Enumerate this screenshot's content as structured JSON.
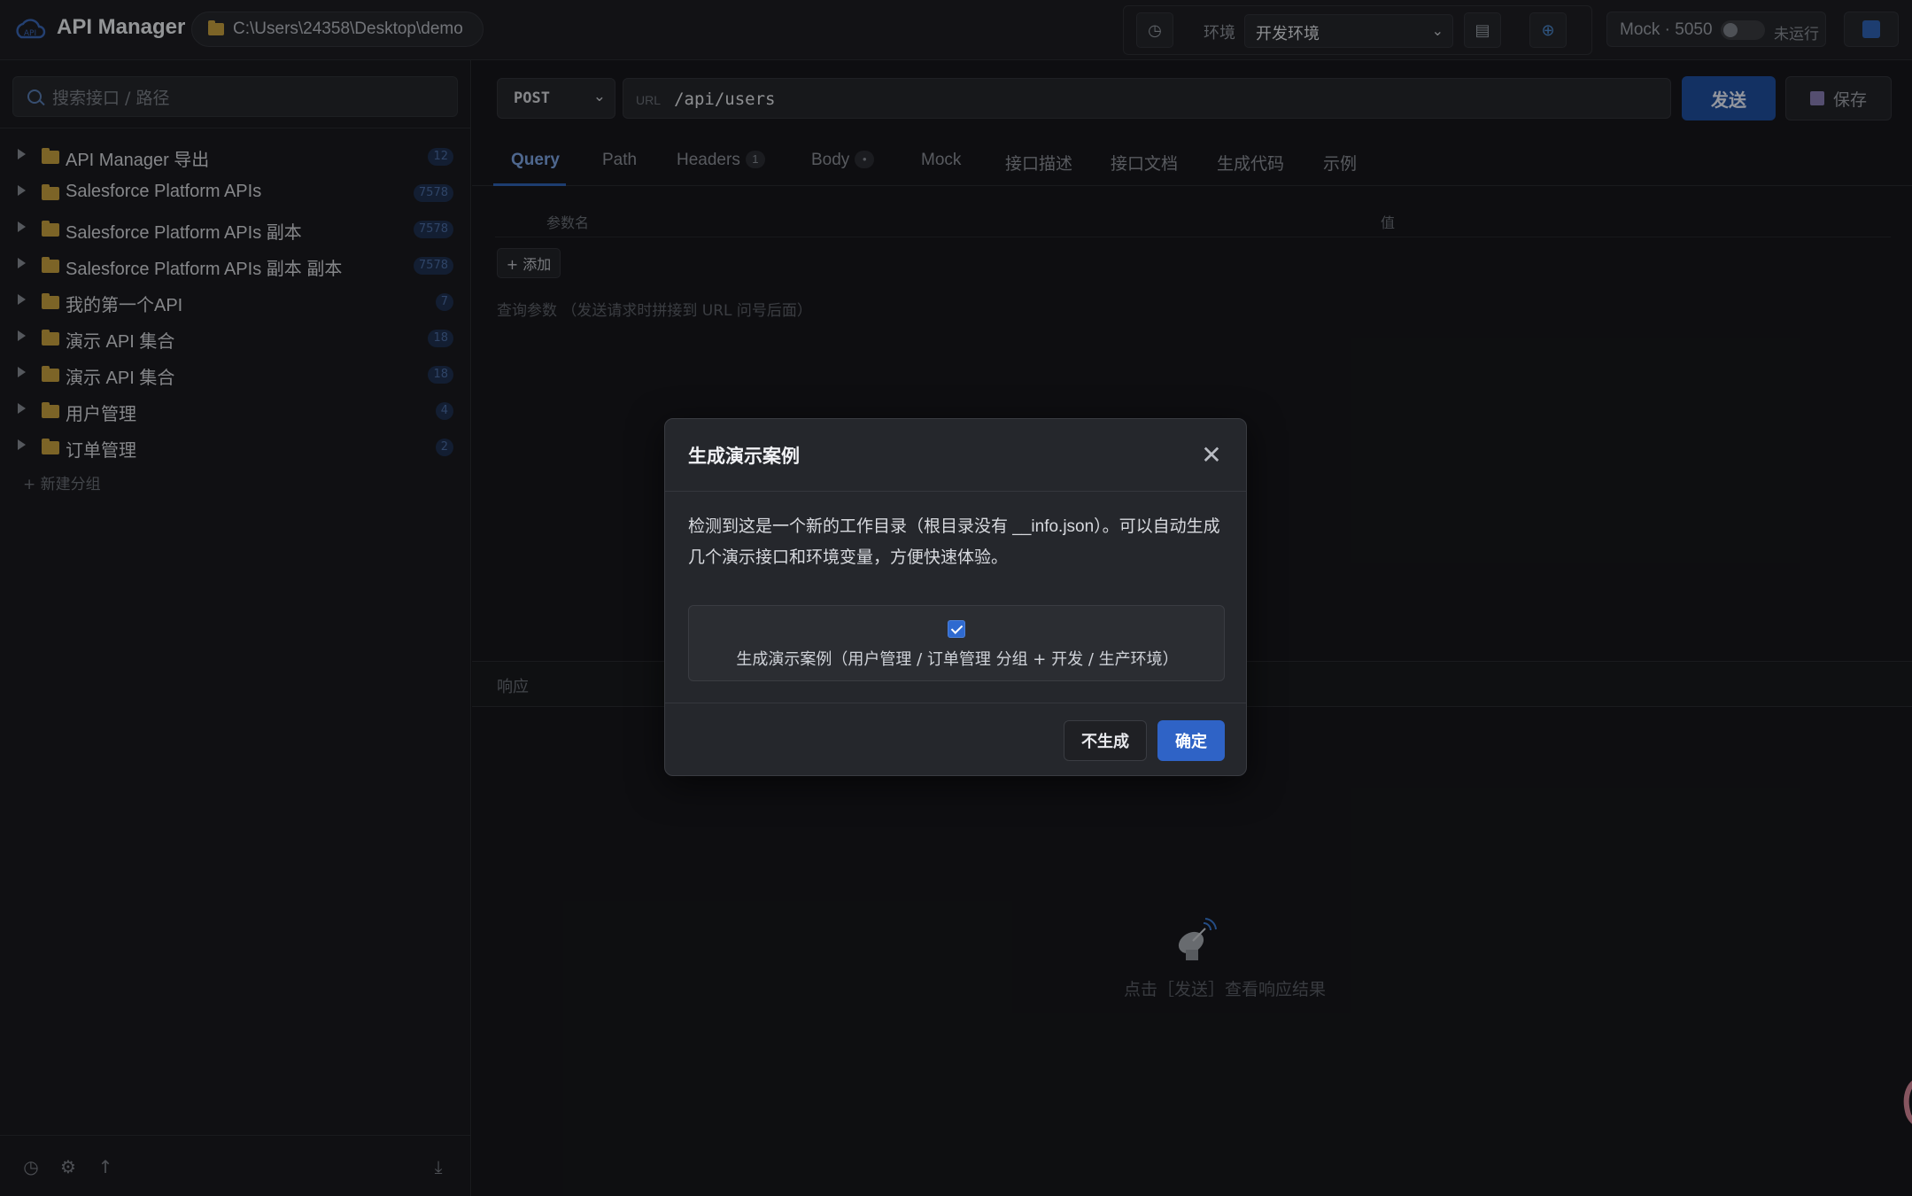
{
  "app": {
    "title": "API Manager",
    "workspace_path": "C:\\Users\\24358\\Desktop\\demo"
  },
  "header": {
    "env_label": "环境",
    "env_selected": "开发环境",
    "mock_label": "Mock · 5050",
    "mock_status": "未运行"
  },
  "sidebar": {
    "search_placeholder": "搜索接口 / 路径",
    "items": [
      {
        "label": "API Manager 导出",
        "count": "12"
      },
      {
        "label": "Salesforce Platform APIs",
        "count": "7578"
      },
      {
        "label": "Salesforce Platform APIs 副本",
        "count": "7578"
      },
      {
        "label": "Salesforce Platform APIs 副本 副本",
        "count": "7578"
      },
      {
        "label": "我的第一个API",
        "count": "7"
      },
      {
        "label": "演示 API 集合",
        "count": "18"
      },
      {
        "label": "演示 API 集合",
        "count": "18"
      },
      {
        "label": "用户管理",
        "count": "4"
      },
      {
        "label": "订单管理",
        "count": "2"
      }
    ],
    "new_group": "+ 新建分组"
  },
  "request": {
    "method": "POST",
    "url_prefix": "URL",
    "url": "/api/users",
    "send_label": "发送",
    "save_label": "保存"
  },
  "tabs": [
    {
      "label": "Query"
    },
    {
      "label": "Path"
    },
    {
      "label": "Headers",
      "badge": "1"
    },
    {
      "label": "Body",
      "badge": "•"
    },
    {
      "label": "Mock"
    },
    {
      "label": "接口描述"
    },
    {
      "label": "接口文档"
    },
    {
      "label": "生成代码"
    },
    {
      "label": "示例"
    }
  ],
  "params": {
    "col_name": "参数名",
    "col_value": "值",
    "add_label": "+ 添加",
    "hint": "查询参数 （发送请求时拼接到 URL 问号后面）"
  },
  "response": {
    "title": "响应",
    "empty_text": "点击［发送］查看响应结果"
  },
  "modal": {
    "title": "生成演示案例",
    "body": "检测到这是一个新的工作目录（根目录没有 __info.json）。可以自动生成几个演示接口和环境变量，方便快速体验。",
    "option_label": "生成演示案例（用户管理 / 订单管理 分组 + 开发 / 生产环境）",
    "option_checked": true,
    "cancel_label": "不生成",
    "ok_label": "确定"
  }
}
